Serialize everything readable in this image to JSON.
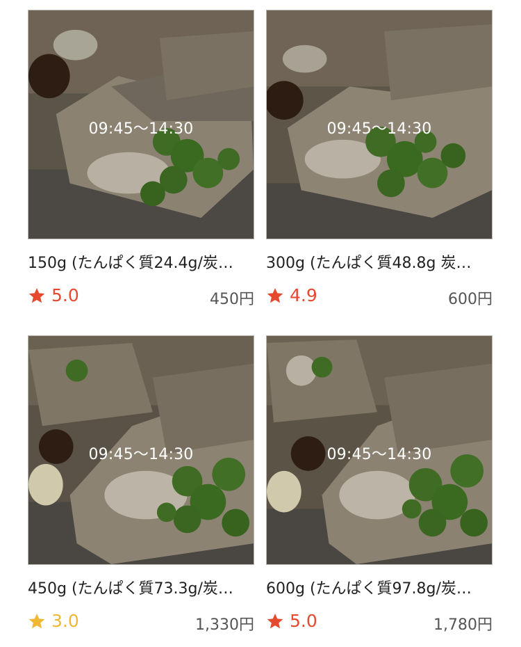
{
  "products": [
    {
      "time": "09:45〜14:30",
      "title": "150g (たんぱく質24.4g/炭…",
      "rating": "5.0",
      "rating_color": "#e64a2e",
      "price": "450円",
      "image_icon": "chicken-broccoli-box-image"
    },
    {
      "time": "09:45〜14:30",
      "title": "300g (たんぱく質48.8g 炭…",
      "rating": "4.9",
      "rating_color": "#e64a2e",
      "price": "600円",
      "image_icon": "chicken-broccoli-box-image"
    },
    {
      "time": "09:45〜14:30",
      "title": "450g (たんぱく質73.3g/炭…",
      "rating": "3.0",
      "rating_color": "#f0b733",
      "price": "1,330円",
      "image_icon": "chicken-broccoli-box-image"
    },
    {
      "time": "09:45〜14:30",
      "title": "600g (たんぱく質97.8g/炭…",
      "rating": "5.0",
      "rating_color": "#e64a2e",
      "price": "1,780円",
      "image_icon": "chicken-broccoli-box-image"
    }
  ]
}
